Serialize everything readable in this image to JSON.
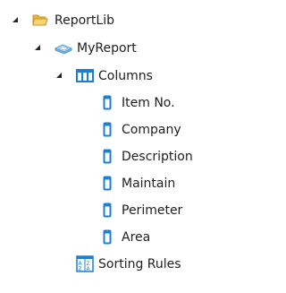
{
  "tree": {
    "root": {
      "label": "ReportLib",
      "icon": "folder-icon",
      "expanded": true,
      "report": {
        "label": "MyReport",
        "icon": "report-icon",
        "expanded": true,
        "columns": {
          "label": "Columns",
          "icon": "columns-icon",
          "expanded": true,
          "items": [
            {
              "label": "Item No.",
              "icon": "column-field-icon"
            },
            {
              "label": "Company",
              "icon": "column-field-icon"
            },
            {
              "label": "Description",
              "icon": "column-field-icon"
            },
            {
              "label": "Maintain",
              "icon": "column-field-icon"
            },
            {
              "label": "Perimeter",
              "icon": "column-field-icon"
            },
            {
              "label": "Area",
              "icon": "column-field-icon"
            }
          ]
        },
        "sorting": {
          "label": "Sorting Rules",
          "icon": "sorting-rules-icon"
        }
      }
    }
  },
  "colors": {
    "folder": "#f2c14e",
    "accent": "#1c7fd6",
    "arrow": "#262626",
    "text": "#1e1e1e"
  }
}
